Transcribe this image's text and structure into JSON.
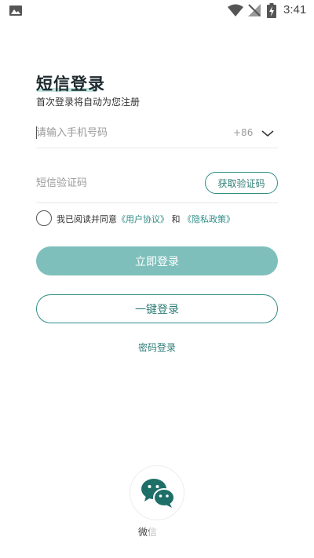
{
  "status_bar": {
    "time": "3:41"
  },
  "header": {
    "title": "短信登录",
    "subtitle": "首次登录将自动为您注册"
  },
  "phone": {
    "placeholder": "请输入手机号码",
    "country_code": "+86"
  },
  "code": {
    "placeholder": "短信验证码",
    "get_code_label": "获取验证码"
  },
  "agreement": {
    "prefix": "我已阅读并同意",
    "user_agreement": "《用户协议》",
    "conjunction": "和",
    "privacy_policy": "《隐私政策》"
  },
  "buttons": {
    "login": "立即登录",
    "one_key": "一键登录",
    "password_login": "密码登录"
  },
  "social": {
    "wechat_label": "微信"
  },
  "colors": {
    "accent": "#2e8d86",
    "button_fill": "#7ebfbb",
    "wechat_icon": "#1e6f68"
  }
}
